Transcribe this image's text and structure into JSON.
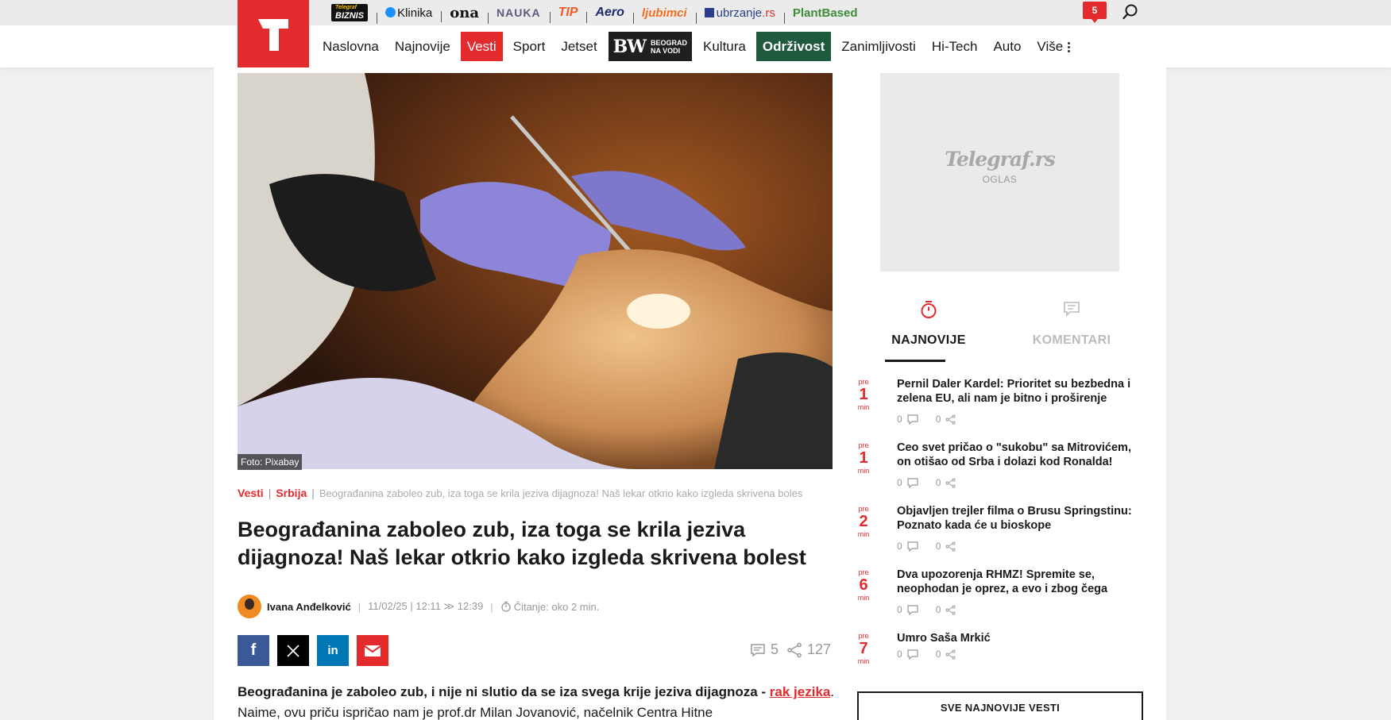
{
  "topbar": {
    "partners": [
      {
        "label": "BIZNIS",
        "sub": "Telegraf"
      },
      {
        "label": "Klinika"
      },
      {
        "label": "ona"
      },
      {
        "label": "NAUKA"
      },
      {
        "label": "TIP"
      },
      {
        "label": "Aero"
      },
      {
        "label": "ljubimci"
      },
      {
        "label": "ubrzanje",
        "suffix": ".rs"
      },
      {
        "label": "PlantBased"
      }
    ],
    "notifications_count": "5"
  },
  "nav": {
    "items": [
      "Naslovna",
      "Najnovije",
      "Vesti",
      "Sport",
      "Jetset",
      "Kultura",
      "Održivost",
      "Zanimljivosti",
      "Hi-Tech",
      "Auto",
      "Više"
    ],
    "bw": {
      "logo": "BW",
      "line1": "BEOGRAD",
      "line2": "NA VODI"
    }
  },
  "article": {
    "photo_credit": "Foto: Pixabay",
    "breadcrumb": {
      "cat1": "Vesti",
      "cat2": "Srbija",
      "current": "Beograđanina zaboleo zub, iza toga se krila jeziva dijagnoza! Naš lekar otkrio kako izgleda skrivena boles"
    },
    "title": "Beograđanina zaboleo zub, iza toga se krila jeziva dijagnoza! Naš lekar otkrio kako izgleda skrivena bolest",
    "author": "Ivana Anđelković",
    "datetime": "11/02/25 | 12:11 ≫ 12:39",
    "reading": "Čitanje: oko 2 min.",
    "comments_count": "5",
    "shares_count": "127",
    "lead_bold": "Beograđanina je zaboleo zub, i nije ni slutio da se iza svega krije jeziva dijagnoza - ",
    "lead_link": "rak jezika",
    "lead_rest": ". Naime, ovu priču ispričao nam je prof.dr Milan Jovanović, načelnik Centra Hitne"
  },
  "sidebar": {
    "ad_brand": "Telegraf.rs",
    "ad_label": "OGLAS",
    "tab_latest": "NAJNOVIJE",
    "tab_comments": "KOMENTARI",
    "news": [
      {
        "pre": "pre",
        "n": "1",
        "min": "min",
        "title": "Pernil Daler Kardel: Prioritet su bezbedna i zelena EU, ali nam je bitno i proširenje",
        "comments": "0",
        "shares": "0"
      },
      {
        "pre": "pre",
        "n": "1",
        "min": "min",
        "title": "Ceo svet pričao o \"sukobu\" sa Mitrovićem, on otišao od Srba i dolazi kod Ronalda!",
        "comments": "0",
        "shares": "0"
      },
      {
        "pre": "pre",
        "n": "2",
        "min": "min",
        "title": "Objavljen trejler filma o Brusu Springstinu: Poznato kada će u bioskope",
        "comments": "0",
        "shares": "0"
      },
      {
        "pre": "pre",
        "n": "6",
        "min": "min",
        "title": "Dva upozorenja RHMZ! Spremite se, neophodan je oprez, a evo i zbog čega",
        "comments": "0",
        "shares": "0"
      },
      {
        "pre": "pre",
        "n": "7",
        "min": "min",
        "title": "Umro Saša Mrkić",
        "comments": "0",
        "shares": "0"
      }
    ],
    "all_news": "SVE NAJNOVIJE VESTI"
  }
}
